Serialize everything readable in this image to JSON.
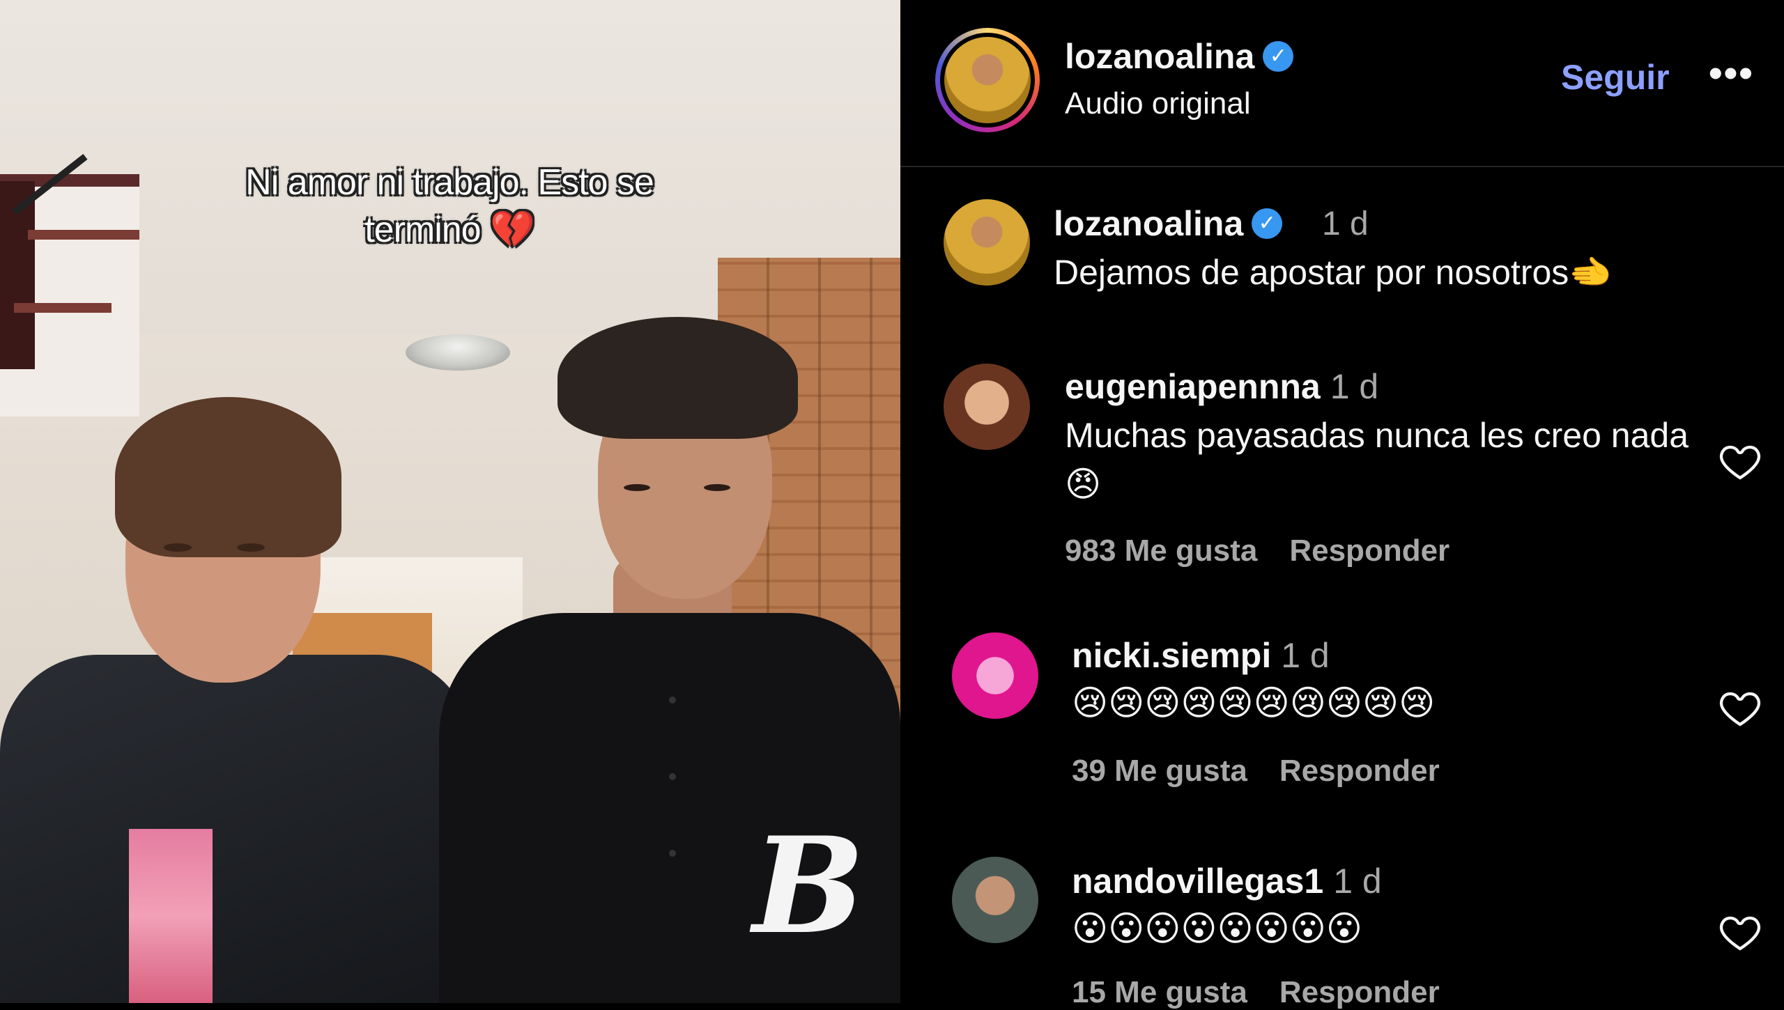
{
  "video": {
    "overlay_text": "Ni amor ni trabajo. Esto se terminó 💔"
  },
  "header": {
    "username": "lozanoalina",
    "subtitle": "Audio original",
    "follow_label": "Seguir",
    "more_label": "•••"
  },
  "caption": {
    "username": "lozanoalina",
    "time": "1 d",
    "text": "Dejamos de apostar por nosotros🫲"
  },
  "comments": [
    {
      "username": "eugeniapennna",
      "time": "1 d",
      "text": "Muchas payasadas nunca les creo nada 😠",
      "likes": "983 Me gusta",
      "reply": "Responder"
    },
    {
      "username": "nicki.siempi",
      "time": "1 d",
      "text": "😢😢😢😢😢😢😢😢😢😢",
      "likes": "39 Me gusta",
      "reply": "Responder"
    },
    {
      "username": "nandovillegas1",
      "time": "1 d",
      "text": "😮😮😮😮😮😮😮😮",
      "likes": "15 Me gusta",
      "reply": "Responder"
    }
  ],
  "colors": {
    "panel_bg": "#000000",
    "follow": "#8da0ff",
    "muted": "#a8a8a8",
    "verified": "#3897f0"
  },
  "icons": [
    "verified-badge-icon",
    "more-options-icon",
    "heart-icon"
  ]
}
